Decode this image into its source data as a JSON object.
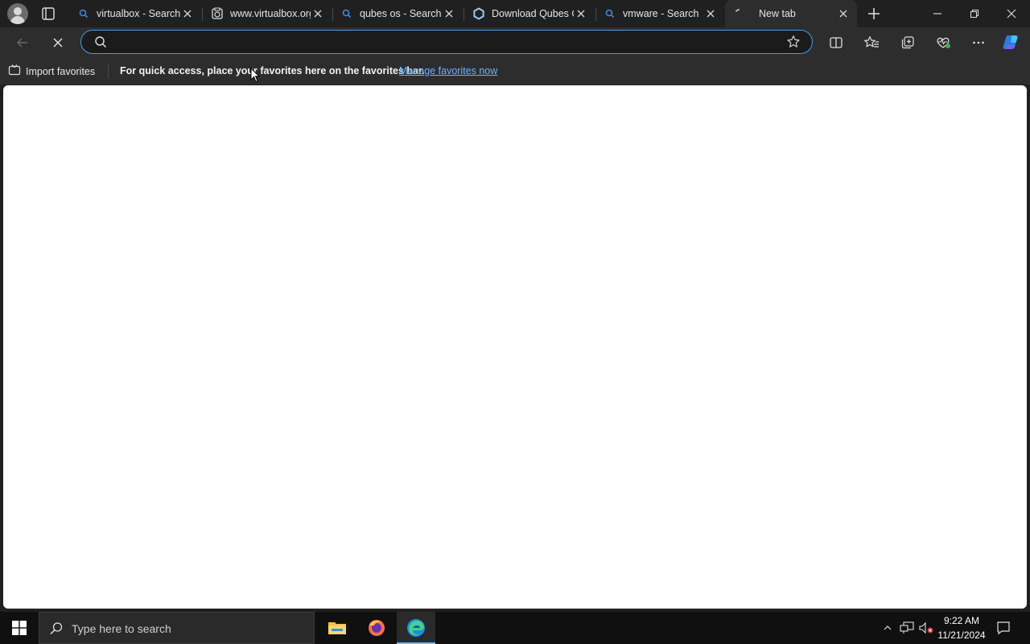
{
  "tabs": [
    {
      "title": "virtualbox - Search",
      "favicon": "search-icon"
    },
    {
      "title": "www.virtualbox.org",
      "favicon": "virtualbox-icon"
    },
    {
      "title": "qubes os - Search",
      "favicon": "search-icon"
    },
    {
      "title": "Download Qubes OS",
      "favicon": "qubes-icon"
    },
    {
      "title": "vmware - Search",
      "favicon": "search-icon"
    },
    {
      "title": "New tab",
      "favicon": "loading-icon",
      "active": true
    }
  ],
  "address_bar": {
    "value": "",
    "placeholder": ""
  },
  "favorites_bar": {
    "import_label": "Import favorites",
    "message": "For quick access, place your favorites here on the favorites bar.",
    "link": "Manage favorites now"
  },
  "taskbar": {
    "search_placeholder": "Type here to search",
    "time": "9:22 AM",
    "date": "11/21/2024"
  },
  "colors": {
    "accent": "#4a9ce8",
    "link": "#6cb4ff",
    "chrome": "#2d2d2d",
    "tabstrip": "#202020"
  }
}
